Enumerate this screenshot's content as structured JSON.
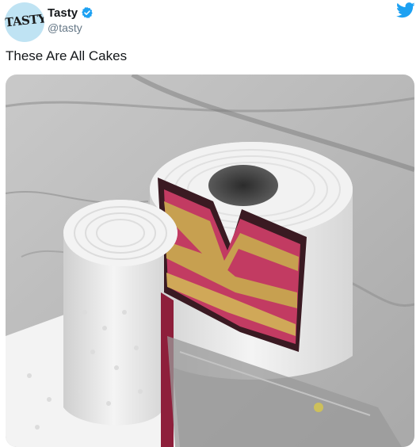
{
  "tweet": {
    "avatar_text": "TASTY",
    "display_name": "Tasty",
    "handle": "@tasty",
    "text": "These Are All Cakes"
  },
  "icons": [
    "verified-badge-icon",
    "twitter-bird-icon"
  ],
  "colors": {
    "avatar_bg": "#bfe3f3",
    "verified": "#1da1f2",
    "twitter_blue": "#1da1f2",
    "cake_sponge_pink": "#c23b62",
    "cake_sponge_yellow": "#c7a050"
  }
}
